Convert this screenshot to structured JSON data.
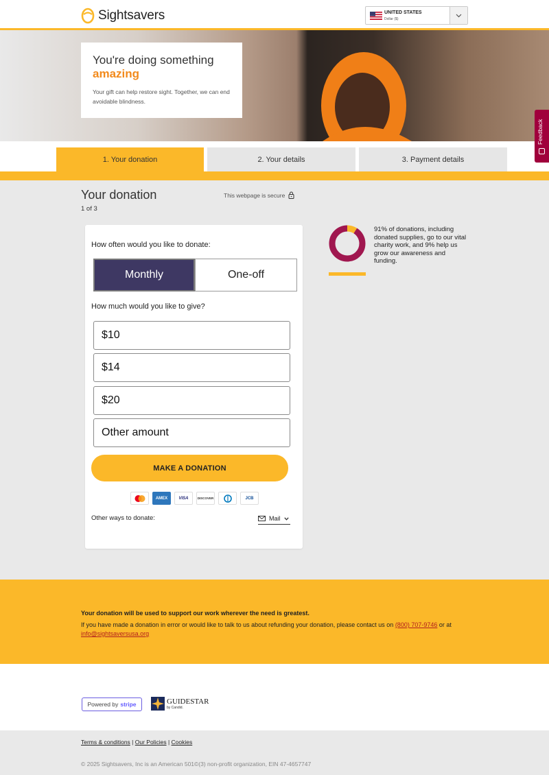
{
  "header": {
    "logo_text": "Sightsavers",
    "country": "UNITED STATES",
    "currency": "Dollar ($)"
  },
  "hero": {
    "title_line1": "You're doing something",
    "title_line2": "amazing",
    "text": "Your gift can help restore sight. Together, we can end avoidable blindness."
  },
  "feedback_label": "Feedback",
  "steps": [
    {
      "label": "1. Your donation",
      "active": true
    },
    {
      "label": "2. Your details",
      "active": false
    },
    {
      "label": "3. Payment details",
      "active": false
    }
  ],
  "page": {
    "title": "Your donation",
    "step_count": "1 of 3",
    "secure_text": "This webpage is secure"
  },
  "form": {
    "frequency_question": "How often would you like to donate:",
    "frequency_options": [
      "Monthly",
      "One-off"
    ],
    "selected_frequency": "Monthly",
    "amount_question": "How much would you like to give?",
    "amounts": [
      "$10",
      "$14",
      "$20",
      "Other amount"
    ],
    "cta_label": "MAKE A DONATION",
    "payment_cards": [
      "mastercard",
      "amex",
      "visa",
      "discover",
      "diners",
      "jcb"
    ],
    "amex_label": "AMEX",
    "visa_label": "VISA",
    "discover_label": "DISCOVER",
    "jcb_label": "JCB",
    "other_ways_label": "Other ways to donate:",
    "other_ways_value": "Mail"
  },
  "info": {
    "text": "91% of donations, including donated supplies, go to our vital charity work, and 9% help us grow our awareness and funding.",
    "charity_percent": 91,
    "colors": {
      "charity": "#a0174f",
      "awareness": "#fbb829"
    }
  },
  "notice": {
    "bold": "Your donation will be used to support our work wherever the need is greatest.",
    "text": "If you have made a donation in error or would like to talk to us about refunding your donation, please contact us on",
    "phone": "(800) 707-9746",
    "or_at": "or at",
    "email": "info@sightsaversusa.org"
  },
  "trust": {
    "stripe_prefix": "Powered by",
    "stripe_brand": "stripe",
    "guidestar_name": "GUIDESTAR",
    "guidestar_sub": "by Candid."
  },
  "footer": {
    "links": [
      "Terms & conditions",
      "Our Policies",
      "Cookies"
    ],
    "copyright": "© 2025 Sightsavers, Inc is an American 501©(3) non-profit organization, EIN 47-4657747"
  },
  "colors": {
    "accent": "#fbb829",
    "brand_purple": "#3e3863",
    "highlight_orange": "#f28a1c"
  }
}
